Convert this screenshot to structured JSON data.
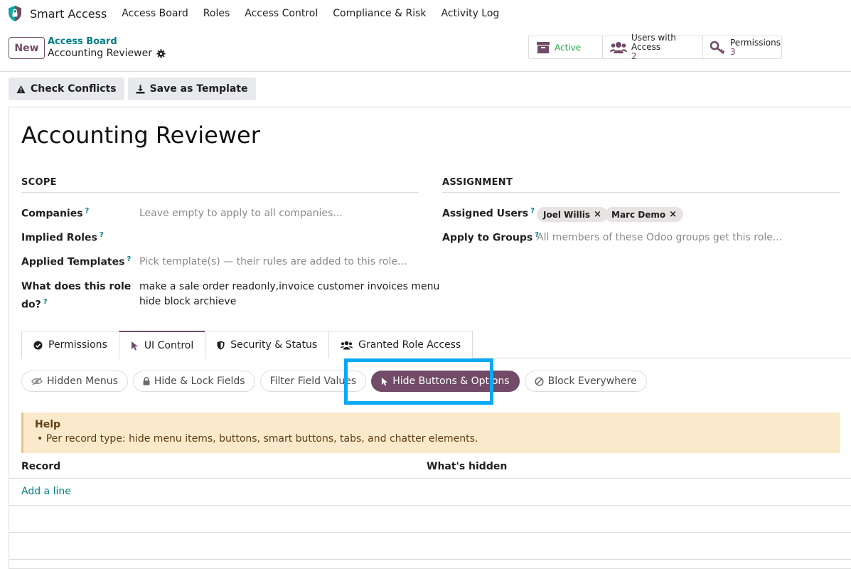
{
  "app": {
    "name": "Smart Access"
  },
  "nav": [
    "Access Board",
    "Roles",
    "Access Control",
    "Compliance & Risk",
    "Activity Log"
  ],
  "control_panel": {
    "new_label": "New",
    "breadcrumb": "Access Board",
    "record_title": "Accounting Reviewer",
    "smart_buttons": {
      "active": "Active",
      "users_label": "Users with Access",
      "users_count": "2",
      "perm_label": "Permissions",
      "perm_count": "3"
    }
  },
  "actions": {
    "check_conflicts": "Check Conflicts",
    "save_template": "Save as Template"
  },
  "form": {
    "title": "Accounting Reviewer",
    "scope": {
      "heading": "SCOPE",
      "companies_label": "Companies",
      "companies_placeholder": "Leave empty to apply to all companies...",
      "implied_label": "Implied Roles",
      "templates_label": "Applied Templates",
      "templates_placeholder": "Pick template(s) — their rules are added to this role...",
      "what_label_1": "What does this role",
      "what_label_2": "do?",
      "what_value_1": "make a sale order readonly,invoice customer invoices menu",
      "what_value_2": "hide block archieve"
    },
    "assignment": {
      "heading": "ASSIGNMENT",
      "users_label": "Assigned Users",
      "users": [
        "Joel Willis",
        "Marc Demo"
      ],
      "groups_label": "Apply to Groups",
      "groups_placeholder": "All members of these Odoo groups get this role..."
    },
    "help_mark": "?"
  },
  "tabs": [
    "Permissions",
    "UI Control",
    "Security & Status",
    "Granted Role Access"
  ],
  "active_tab": "UI Control",
  "pills": [
    "Hidden Menus",
    "Hide & Lock Fields",
    "Filter Field Values",
    "Hide Buttons & Options",
    "Block Everywhere"
  ],
  "active_pill": "Hide Buttons & Options",
  "help": {
    "title": "Help",
    "line": "Per record type: hide menu items, buttons, smart buttons, tabs, and chatter elements."
  },
  "table": {
    "col_record": "Record",
    "col_hidden": "What's hidden",
    "add_line": "Add a line"
  },
  "colors": {
    "brand": "#714b67",
    "link": "#017e84",
    "highlight": "#09a9f3",
    "help_bg": "#fbe9cc"
  }
}
